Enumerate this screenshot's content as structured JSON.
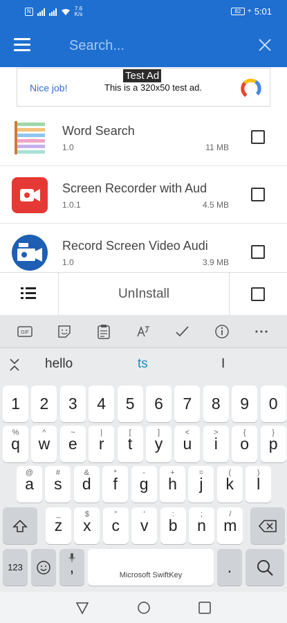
{
  "status": {
    "left_badge": "N",
    "net_speed": "7.6",
    "net_unit": "K/s",
    "battery": "82",
    "time": "5:01"
  },
  "appbar": {
    "search_placeholder": "Search..."
  },
  "ad": {
    "badge": "Test Ad",
    "nice": "Nice job!",
    "text": "This is a 320x50 test ad."
  },
  "apps": [
    {
      "name": "Word Search",
      "version": "1.0",
      "size": "11 MB",
      "icon": "word-search-icon"
    },
    {
      "name": "Screen Recorder with Aud",
      "version": "1.0.1",
      "size": "4.5 MB",
      "icon": "screen-recorder-icon"
    },
    {
      "name": "Record Screen Video Audi",
      "version": "1.0",
      "size": "3.9 MB",
      "icon": "record-screen-icon"
    }
  ],
  "actionbar": {
    "uninstall_label": "UnInstall"
  },
  "keyboard": {
    "toolbar": [
      "gif-icon",
      "sticker-icon",
      "clipboard-icon",
      "translate-icon",
      "tasks-icon",
      "info-icon",
      "more-icon"
    ],
    "suggestions": [
      "hello",
      "ts",
      "I"
    ],
    "row_numbers": [
      "1",
      "2",
      "3",
      "4",
      "5",
      "6",
      "7",
      "8",
      "9",
      "0"
    ],
    "row1": {
      "keys": [
        "q",
        "w",
        "e",
        "r",
        "t",
        "y",
        "u",
        "i",
        "o",
        "p"
      ],
      "subs": [
        "%",
        "^",
        "~",
        "|",
        "[",
        "]",
        "<",
        ">",
        "{",
        "}"
      ]
    },
    "row2": {
      "keys": [
        "a",
        "s",
        "d",
        "f",
        "g",
        "h",
        "j",
        "k",
        "l"
      ],
      "subs": [
        "@",
        "#",
        "&",
        "*",
        "-",
        "+",
        "=",
        "(",
        ")"
      ]
    },
    "row3": {
      "keys": [
        "z",
        "x",
        "c",
        "v",
        "b",
        "n",
        "m"
      ],
      "subs": [
        "_",
        "$",
        "\"",
        "'",
        ":",
        ";",
        "/"
      ]
    },
    "bottom": {
      "num_label": "123",
      "comma": ",",
      "space_label": "Microsoft SwiftKey",
      "period": "."
    }
  }
}
